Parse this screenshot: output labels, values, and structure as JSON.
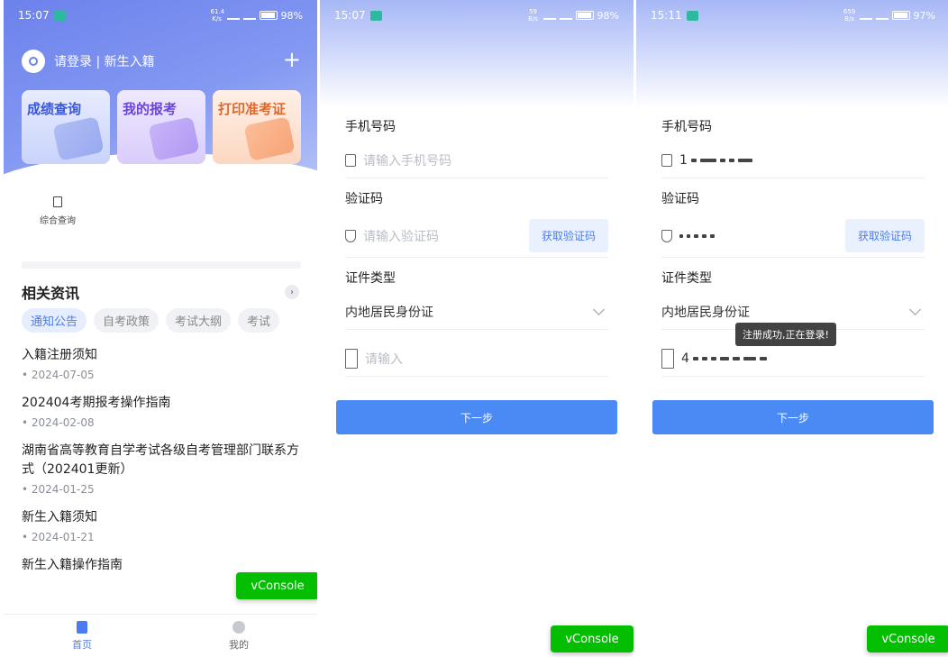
{
  "phone1": {
    "status": {
      "time": "15:07",
      "speed": "61.4 K/s",
      "battery": "98%"
    },
    "login_text": "请登录 | 新生入籍",
    "cards": [
      {
        "label": "成绩查询"
      },
      {
        "label": "我的报考"
      },
      {
        "label": "打印准考证"
      }
    ],
    "quick": {
      "label": "综合查询"
    },
    "news": {
      "title": "相关资讯",
      "tabs": [
        "通知公告",
        "自考政策",
        "考试大纲",
        "考试"
      ],
      "items": [
        {
          "title": "入籍注册须知",
          "date": "2024-07-05"
        },
        {
          "title": "202404考期报考操作指南",
          "date": "2024-02-08"
        },
        {
          "title": "湖南省高等教育自学考试各级自考管理部门联系方式（202401更新）",
          "date": "2024-01-25"
        },
        {
          "title": "新生入籍须知",
          "date": "2024-01-21"
        },
        {
          "title": "新生入籍操作指南",
          "date": ""
        }
      ]
    },
    "vconsole": "vConsole",
    "nav": {
      "home": "首页",
      "me": "我的"
    }
  },
  "phone2": {
    "status": {
      "time": "15:07",
      "speed": "59 B/s",
      "battery": "98%"
    },
    "phone_label": "手机号码",
    "phone_placeholder": "请输入手机号码",
    "code_label": "验证码",
    "code_placeholder": "请输入验证码",
    "get_code": "获取验证码",
    "id_type_label": "证件类型",
    "id_type_value": "内地居民身份证",
    "id_placeholder": "请输入",
    "next": "下一步",
    "vconsole": "vConsole"
  },
  "phone3": {
    "status": {
      "time": "15:11",
      "speed": "659 B/s",
      "battery": "97%"
    },
    "phone_label": "手机号码",
    "phone_value_prefix": "1",
    "code_label": "验证码",
    "get_code": "获取验证码",
    "id_type_label": "证件类型",
    "id_type_value": "内地居民身份证",
    "id_value_prefix": "4",
    "toast": "注册成功,正在登录!",
    "next": "下一步",
    "vconsole": "vConsole"
  }
}
